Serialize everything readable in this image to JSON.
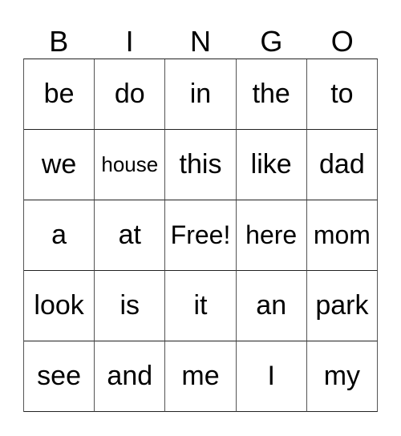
{
  "header": {
    "letters": [
      "B",
      "I",
      "N",
      "G",
      "O"
    ]
  },
  "grid": {
    "rows": [
      [
        "be",
        "do",
        "in",
        "the",
        "to"
      ],
      [
        "we",
        "house",
        "this",
        "like",
        "dad"
      ],
      [
        "a",
        "at",
        "Free!",
        "here",
        "mom"
      ],
      [
        "look",
        "is",
        "it",
        "an",
        "park"
      ],
      [
        "see",
        "and",
        "me",
        "I",
        "my"
      ]
    ]
  }
}
